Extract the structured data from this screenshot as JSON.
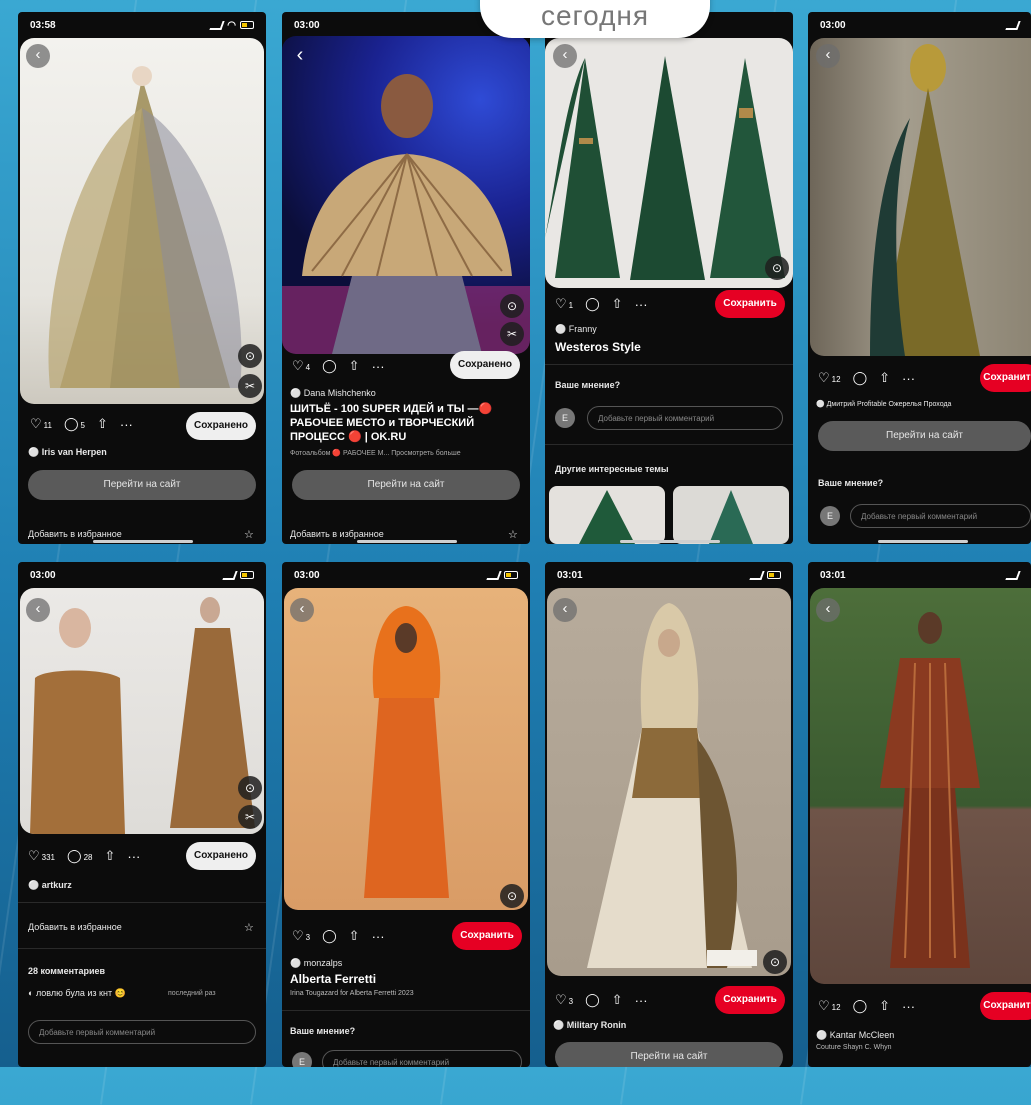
{
  "header": {
    "today_label": "сегодня"
  },
  "common": {
    "save": "Сохранить",
    "saved": "Сохранено",
    "visit_site": "Перейти на сайт",
    "add_to_favorites": "Добавить в избранное",
    "your_opinion": "Ваше мнение?",
    "comment_placeholder": "Добавьте первый комментарий",
    "avatar_letter": "E",
    "more": "···"
  },
  "phones": [
    {
      "time": "03:58",
      "likes": "11",
      "comments": "5",
      "author": "Iris van Herpen"
    },
    {
      "time": "03:00",
      "likes": "4",
      "author": "Dana Mishchenko",
      "title": "ШИТЬЁ - 100 SUPER ИДЕЙ и ТЫ —🔴 РАБОЧЕЕ МЕСТО и ТВОРЧЕСКИЙ ПРОЦЕСС 🔴 | OK.RU",
      "subtitle": "Фотоальбом 🔴 РАБОЧЕЕ М... Просмотреть больше"
    },
    {
      "author": "Franny",
      "title": "Westeros Style",
      "likes": "1",
      "more_topics": "Другие интересные темы"
    },
    {
      "time": "03:00",
      "likes": "12",
      "author": "Дмитрий Profitable Ожерелья Прохода"
    },
    {
      "time": "03:00",
      "likes": "331",
      "comments": "28",
      "author": "artkurz",
      "comments_count": "28 комментариев",
      "comment_text": "ловлю була из кнт 😊",
      "comment_meta": "последний раз"
    },
    {
      "time": "03:00",
      "likes": "3",
      "author": "monzalps",
      "title": "Alberta Ferretti",
      "subtitle": "Irina Tougazard for Alberta Ferretti 2023"
    },
    {
      "time": "03:01",
      "likes": "3",
      "author": "Military Ronin"
    },
    {
      "time": "03:01",
      "likes": "12",
      "author": "Kantar McCleen",
      "subtitle": "Couture Shayn C. Whyn"
    }
  ],
  "colors": {
    "accent_red": "#e60023",
    "card_bg": "#0c0c0c",
    "page_bg": "#1f7fb3"
  }
}
